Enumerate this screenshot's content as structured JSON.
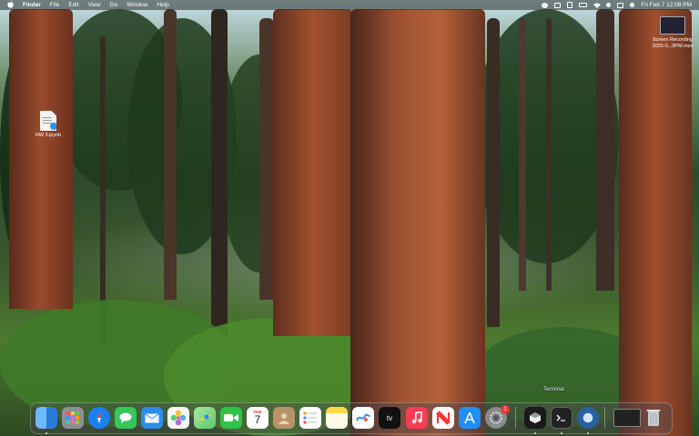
{
  "menubar": {
    "apple": "",
    "app_name": "Finder",
    "menus": [
      "File",
      "Edit",
      "View",
      "Go",
      "Window",
      "Help"
    ],
    "clock": "Fri Feb 7  12:08 PM"
  },
  "desktop": {
    "files": [
      {
        "name": "HW 3.ipynb",
        "icon": "notebook-file-icon"
      },
      {
        "name": "Screen Recording\n2025-0...9PM.mov",
        "icon": "video-file-icon"
      }
    ]
  },
  "dock": {
    "tooltip": "Terminal",
    "apps": [
      {
        "name": "Finder",
        "icon": "finder-icon",
        "color": "#2f8ef0"
      },
      {
        "name": "Launchpad",
        "icon": "launchpad-icon",
        "color": "#8e8e93"
      },
      {
        "name": "Safari",
        "icon": "safari-icon",
        "color": "#1a7ff0"
      },
      {
        "name": "Messages",
        "icon": "messages-icon",
        "color": "#34c759"
      },
      {
        "name": "Mail",
        "icon": "mail-icon",
        "color": "#2e8bf2"
      },
      {
        "name": "Photos",
        "icon": "photos-icon",
        "color": "#f5f5f5"
      },
      {
        "name": "Maps",
        "icon": "maps-icon",
        "color": "#5cc96b"
      },
      {
        "name": "FaceTime",
        "icon": "facetime-icon",
        "color": "#30c24a"
      },
      {
        "name": "Calendar",
        "icon": "calendar-icon",
        "color": "#ffffff",
        "month": "FEB",
        "day": "7"
      },
      {
        "name": "Contacts",
        "icon": "contacts-icon",
        "color": "#b8936a"
      },
      {
        "name": "Reminders",
        "icon": "reminders-icon",
        "color": "#ffffff"
      },
      {
        "name": "Notes",
        "icon": "notes-icon",
        "color": "#ffd94a"
      },
      {
        "name": "Freeform",
        "icon": "freeform-icon",
        "color": "#ffffff"
      },
      {
        "name": "TV",
        "icon": "tv-icon",
        "color": "#111111",
        "label": "tv"
      },
      {
        "name": "Music",
        "icon": "music-icon",
        "color": "#fa3c55"
      },
      {
        "name": "News",
        "icon": "news-icon",
        "color": "#ffffff"
      },
      {
        "name": "App Store",
        "icon": "app-store-icon",
        "color": "#1f8ef5"
      },
      {
        "name": "System Settings",
        "icon": "settings-icon",
        "color": "#8a8a8f",
        "badge": "1"
      },
      {
        "name": "Cursor",
        "icon": "cursor-icon",
        "color": "#1a1a1a"
      },
      {
        "name": "Terminal",
        "icon": "terminal-icon",
        "color": "#222222"
      },
      {
        "name": "QuickTime Player",
        "icon": "quicktime-icon",
        "color": "#2b5f9e"
      },
      {
        "name": "Screen Recording",
        "icon": "recording-thumb-icon",
        "color": "#222222"
      },
      {
        "name": "Trash",
        "icon": "trash-icon",
        "color": "#c9ccd0"
      }
    ]
  }
}
